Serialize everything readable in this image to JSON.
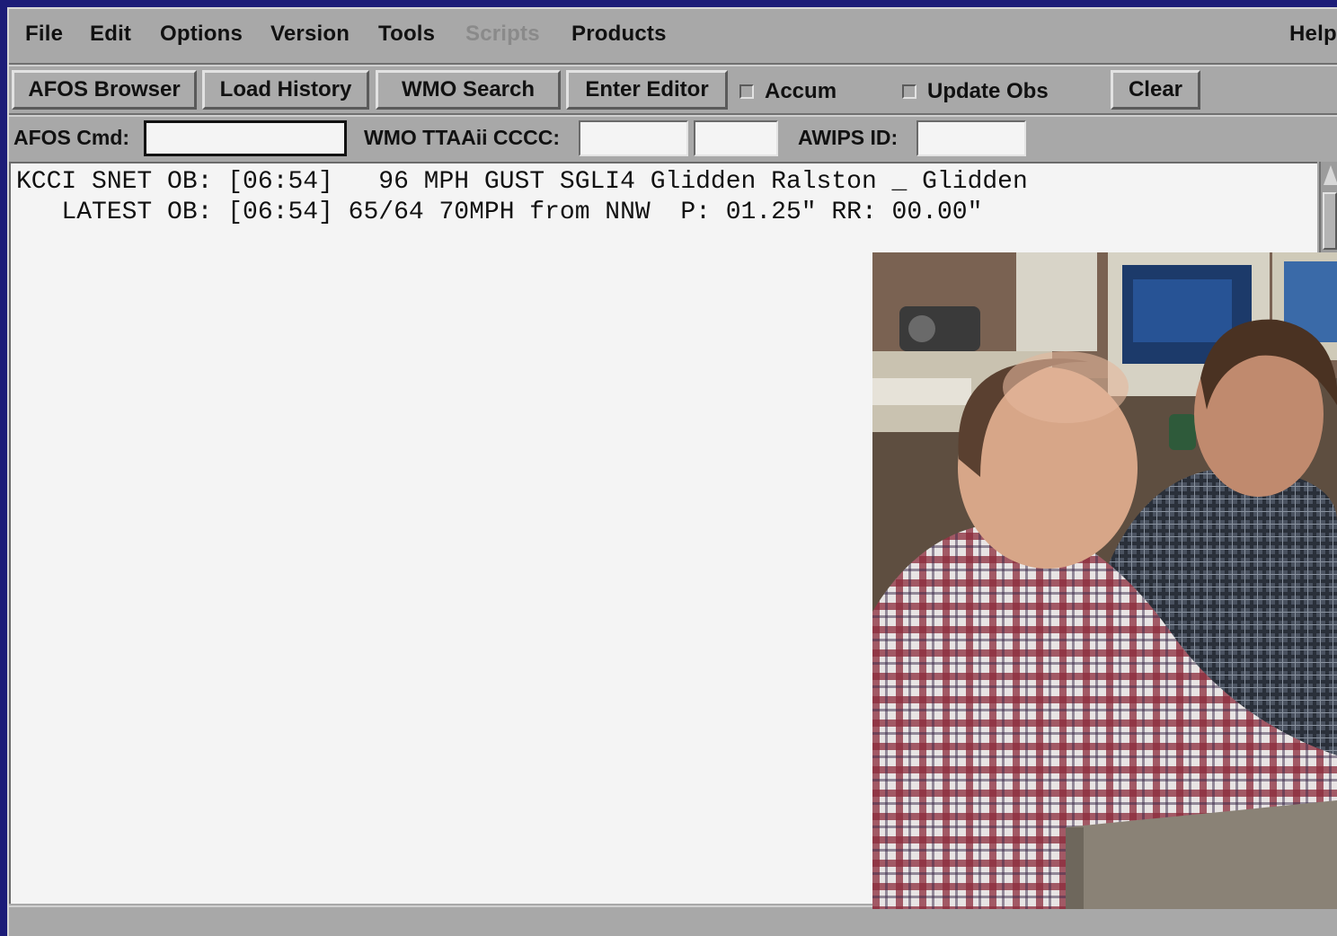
{
  "menubar": {
    "items": [
      {
        "label": "File"
      },
      {
        "label": "Edit"
      },
      {
        "label": "Options"
      },
      {
        "label": "Version"
      },
      {
        "label": "Tools"
      },
      {
        "label": "Scripts",
        "disabled": true
      },
      {
        "label": "Products"
      }
    ],
    "help": "Help"
  },
  "toolbar": {
    "afos_browser": "AFOS Browser",
    "load_history": "Load History",
    "wmo_search": "WMO Search",
    "enter_editor": "Enter Editor",
    "accum": {
      "label": "Accum",
      "checked": false
    },
    "update_obs": {
      "label": "Update Obs",
      "checked": false
    },
    "clear": "Clear"
  },
  "inputs": {
    "afos_cmd": {
      "label": "AFOS Cmd:",
      "value": ""
    },
    "wmo": {
      "label": "WMO TTAAii CCCC:",
      "ttaaii": "",
      "cccc": ""
    },
    "awips": {
      "label": "AWIPS ID:",
      "value": ""
    }
  },
  "text": {
    "lines": [
      "KCCI SNET OB: [06:54]   96 MPH GUST SGLI4 Glidden Ralston _ Glidden",
      "   LATEST OB: [06:54] 65/64 70MPH from NNW  P: 01.25\" RR: 00.00\""
    ]
  },
  "colors": {
    "desktop": "#1c1c78",
    "window": "#a8a8a8",
    "text_bg": "#f4f4f4"
  }
}
